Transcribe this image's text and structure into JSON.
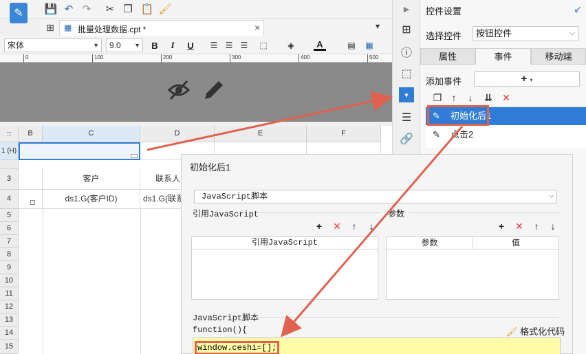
{
  "toolbar": {
    "icons": [
      "save-icon",
      "undo-icon",
      "redo-icon",
      "cut-icon",
      "copy-icon",
      "paste-icon",
      "format-brush-icon"
    ]
  },
  "tab": {
    "file_name": "批量处理数据.cpt *",
    "close": "×"
  },
  "fontbar": {
    "font_family": "宋体",
    "font_size": "9.0",
    "bold": "B",
    "italic": "I",
    "underline": "U",
    "font_color_letter": "A"
  },
  "ruler": {
    "ticks": [
      "0",
      "100",
      "200",
      "300",
      "400",
      "500"
    ]
  },
  "grid": {
    "corner": ":::",
    "columns": [
      "B",
      "C",
      "D",
      "E",
      "F"
    ],
    "rows": [
      "1 (H)",
      "",
      "3",
      "4",
      "5",
      "6",
      "7",
      "8",
      "9",
      "10",
      "11",
      "12",
      "13",
      "14",
      "15"
    ],
    "cells": {
      "c3": "客户",
      "d3": "联系人",
      "c4": "ds1.G(客户ID)",
      "d4": "ds1.G(联系"
    }
  },
  "panel": {
    "title": "控件设置",
    "select_widget_label": "选择控件",
    "select_widget_value": "按钮控件",
    "tabs": [
      "属性",
      "事件",
      "移动端"
    ],
    "active_tab": "事件",
    "add_event_label": "添加事件",
    "add_event_btn": "+",
    "events": [
      "初始化后1",
      "点击2"
    ]
  },
  "dialog": {
    "title": "初始化后1",
    "type_value": "JavaScript脚本",
    "ref_js_section": "引用JavaScript",
    "params_section": "参数",
    "ref_js_col": "引用JavaScript",
    "params_col": "参数",
    "value_col": "值",
    "js_section": "JavaScript脚本",
    "func_header": "function(){",
    "format_code": "格式化代码",
    "code": "window.ceshi=[];"
  },
  "colors": {
    "accent": "#2f7dd6",
    "highlight": "#e0624e",
    "code_bg": "#fffca8"
  }
}
